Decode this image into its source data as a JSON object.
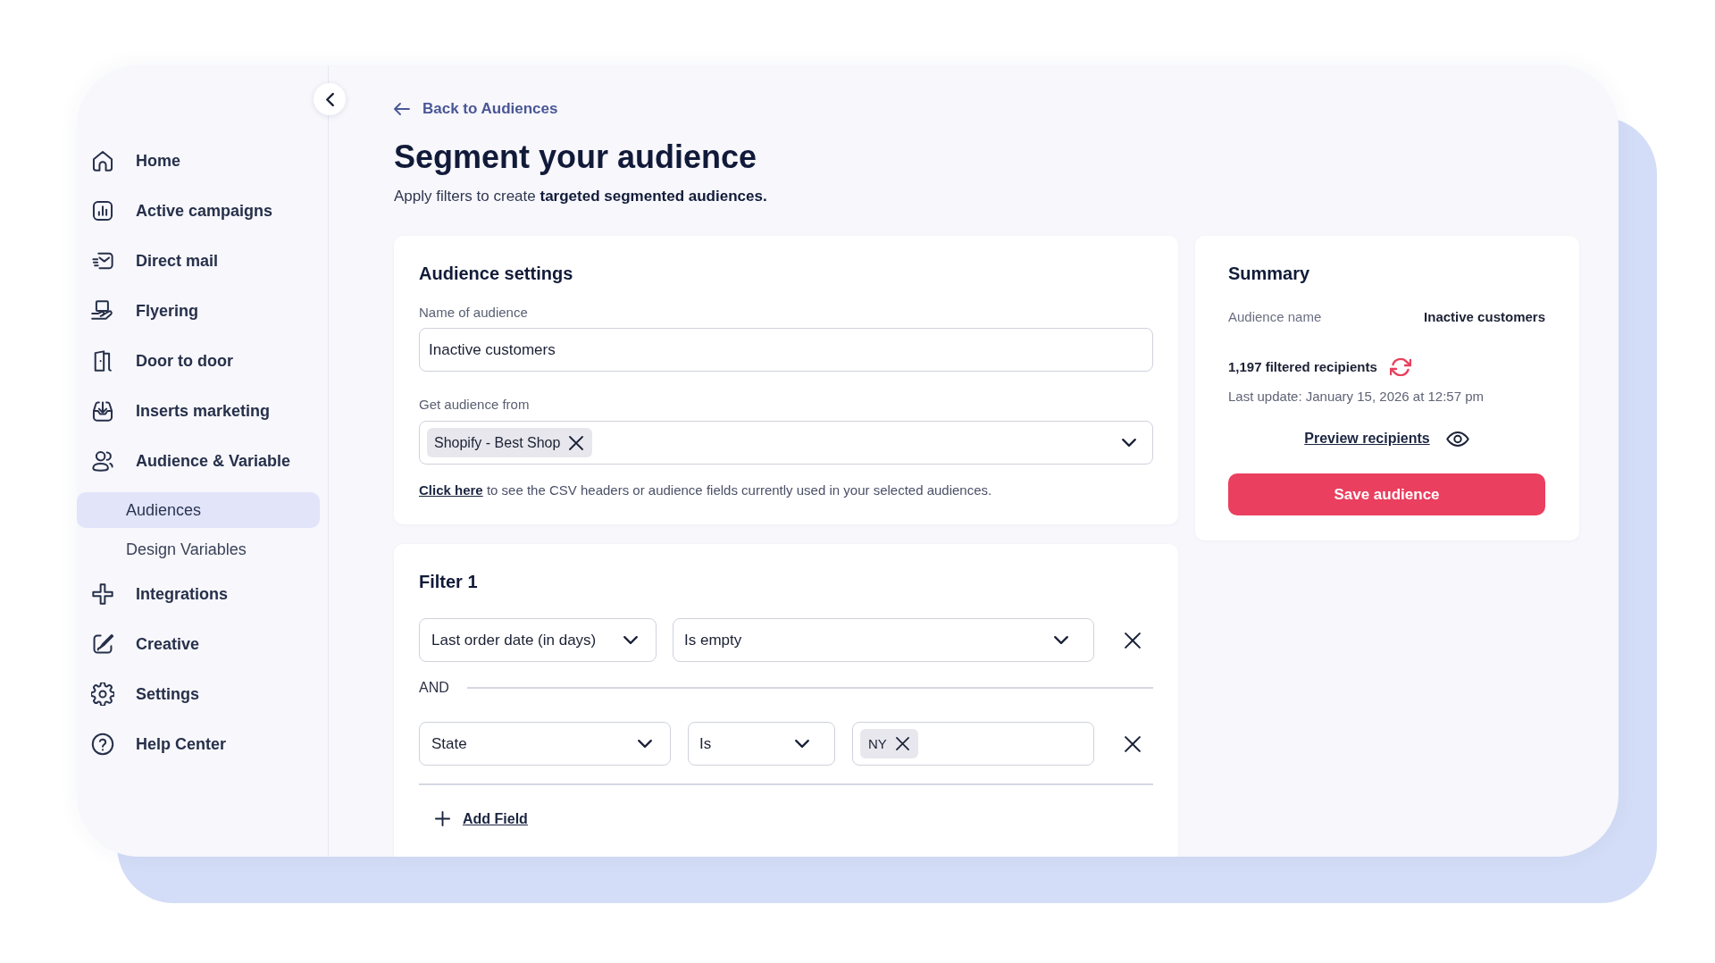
{
  "sidebar": {
    "items": [
      {
        "label": "Home",
        "selected": false
      },
      {
        "label": "Active campaigns",
        "selected": false
      },
      {
        "label": "Direct mail",
        "selected": false
      },
      {
        "label": "Flyering",
        "selected": false
      },
      {
        "label": "Door to door",
        "selected": false
      },
      {
        "label": "Inserts marketing",
        "selected": false
      },
      {
        "label": "Audience & Variable",
        "selected": false,
        "children": [
          {
            "label": "Audiences",
            "selected": true
          },
          {
            "label": "Design Variables",
            "selected": false
          }
        ]
      },
      {
        "label": "Integrations",
        "selected": false
      },
      {
        "label": "Creative",
        "selected": false
      },
      {
        "label": "Settings",
        "selected": false
      },
      {
        "label": "Help Center",
        "selected": false
      }
    ]
  },
  "header": {
    "back_link": "Back to Audiences",
    "title": "Segment your audience",
    "subtitle": "Apply filters to create **targeted segmented audiences.**"
  },
  "audience_settings": {
    "title": "Audience settings",
    "name_field": {
      "label": "Name of audience",
      "value": "Inactive customers"
    },
    "source_field": {
      "label": "Get audience from",
      "chips": [
        "Shopify - Best Shop"
      ]
    },
    "note": {
      "link": "Click here",
      "text": "to see the CSV headers or audience fields currently used in your selected audiences."
    }
  },
  "summary": {
    "title": "Summary",
    "audience_name_label": "Audience name",
    "audience_name_value": "Inactive customers",
    "recipients": "1,197 filtered recipients",
    "last_update": "Last update: January 15, 2026 at 12:57 pm",
    "preview_link": "Preview recipients",
    "save_button": "Save audience"
  },
  "filter": {
    "title": "Filter 1",
    "conditions": [
      {
        "field": "Last order date (in days)",
        "operator": "Is empty"
      },
      {
        "joiner": "AND",
        "field": "State",
        "operator": "Is",
        "values": [
          "NY"
        ]
      }
    ],
    "add_button": "Add Field"
  }
}
